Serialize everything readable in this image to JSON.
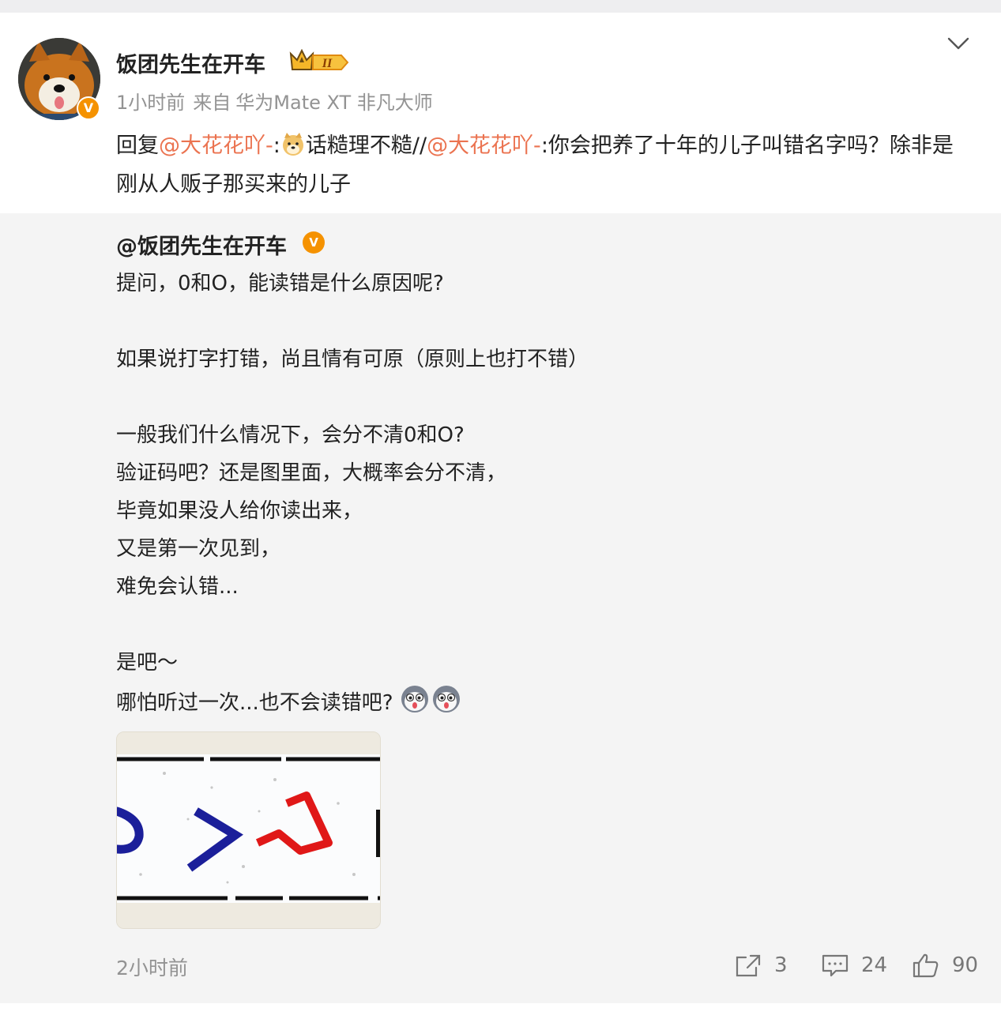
{
  "post": {
    "username": "饭团先生在开车",
    "meta": {
      "time": "1小时前",
      "source_prefix": "来自",
      "source": "华为Mate XT 非凡大师"
    },
    "reply": {
      "prefix": "回复",
      "mention1": "@大花花吖-",
      "colon1": ":",
      "text1": "话糙理不糙//",
      "mention2": "@大花花吖-",
      "colon2": ":",
      "text2": "你会把养了十年的儿子叫错名字吗？除非是刚从人贩子那买来的儿子"
    }
  },
  "quote": {
    "username": "@饭团先生在开车",
    "lines": [
      "提问，0和O，能读错是什么原因呢?",
      "如果说打字打错，尚且情有可原（原则上也打不错）",
      "一般我们什么情况下，会分不清0和O?",
      "验证码吧？还是图里面，大概率会分不清，",
      "毕竟如果没人给你读出来，",
      "又是第一次见到，",
      "难免会认错...",
      "是吧～",
      "哪怕听过一次...也不会读错吧?"
    ],
    "time": "2小时前",
    "actions": {
      "share_count": "3",
      "comment_count": "24",
      "like_count": "90"
    }
  },
  "colors": {
    "mention": "#eb7350",
    "verified": "#f59200",
    "muted": "#939393"
  },
  "icons": [
    "chevron-down-icon",
    "share-icon",
    "comment-icon",
    "like-icon",
    "verified-icon",
    "crown-icon",
    "doge-emoji",
    "husky-emoji"
  ]
}
